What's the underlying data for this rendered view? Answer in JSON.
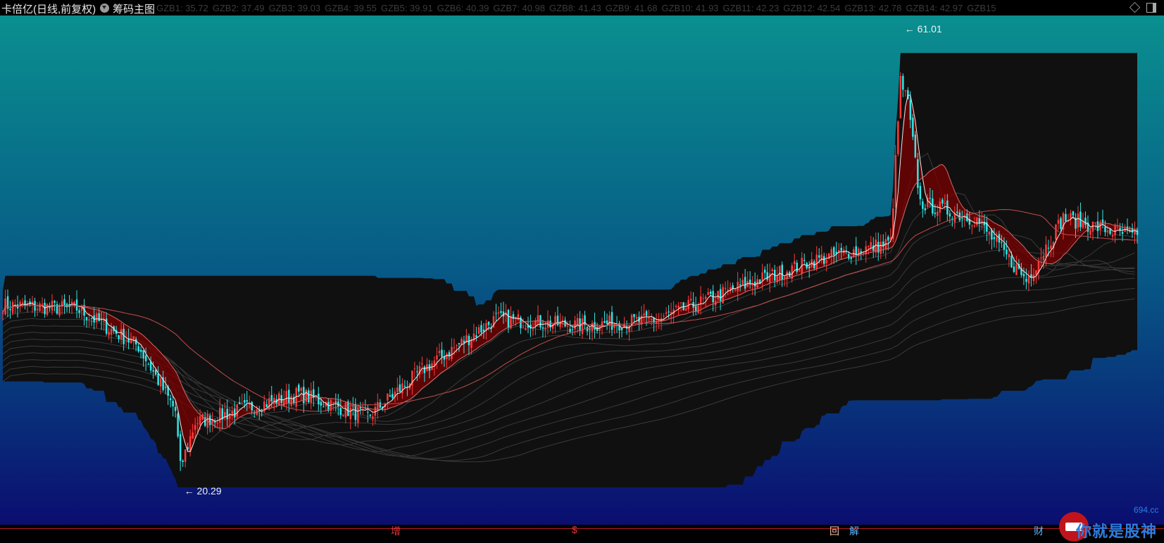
{
  "header": {
    "title": "卡倍亿(日线,前复权)",
    "indicator_tab": "筹码主图",
    "gzb": [
      "GZB1: 35.72",
      "GZB2: 37.49",
      "GZB3: 39.03",
      "GZB4: 39.55",
      "GZB5: 39.91",
      "GZB6: 40.39",
      "GZB7: 40.98",
      "GZB8: 41.43",
      "GZB9: 41.68",
      "GZB10: 41.93",
      "GZB11: 42.23",
      "GZB12: 42.54",
      "GZB13: 42.78",
      "GZB14: 42.97",
      "GZB15"
    ]
  },
  "events": [
    {
      "label": "增",
      "color": "#e23a3a"
    },
    {
      "label": "$",
      "color": "#e23a3a"
    },
    {
      "label": "回",
      "color": "#f0c0a0"
    },
    {
      "label": "解",
      "color": "#5ab8ff"
    },
    {
      "label": "财",
      "color": "#5ab8ff"
    }
  ],
  "indicator_bar": {
    "name": "",
    "value": ""
  },
  "watermark": {
    "text": "你就是股神",
    "site": "694.cc"
  },
  "colors": {
    "up": "#ff3a3a",
    "down": "#33e6e6",
    "ma": "#f2e6e6"
  },
  "chart_data": {
    "type": "candlestick",
    "title": "卡倍亿(日线,前复权)",
    "ylim": [
      20.29,
      61.01
    ],
    "high_marker": {
      "value": 61.01,
      "label": "61.01"
    },
    "low_marker": {
      "value": 20.29,
      "label": "20.29"
    },
    "anchors": [
      [
        0,
        36.3
      ],
      [
        30,
        36.0
      ],
      [
        55,
        32.7
      ],
      [
        70,
        27.0
      ],
      [
        72,
        22.0
      ],
      [
        78,
        26.0
      ],
      [
        120,
        28.5
      ],
      [
        148,
        26.5
      ],
      [
        170,
        30.6
      ],
      [
        200,
        35.1
      ],
      [
        233,
        34.5
      ],
      [
        265,
        35.0
      ],
      [
        300,
        38.0
      ],
      [
        330,
        40.3
      ],
      [
        360,
        41.8
      ],
      [
        364,
        56.0
      ],
      [
        367,
        54.0
      ],
      [
        372,
        45.3
      ],
      [
        395,
        43.8
      ],
      [
        415,
        38.5
      ],
      [
        430,
        44.0
      ],
      [
        460,
        42.2
      ]
    ]
  }
}
